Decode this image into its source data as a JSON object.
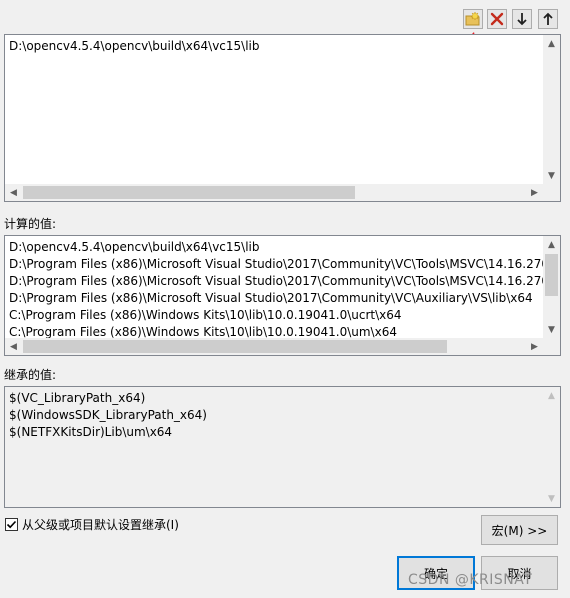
{
  "directory_list": {
    "entries": [
      "D:\\opencv4.5.4\\opencv\\build\\x64\\vc15\\lib"
    ]
  },
  "toolbar": {
    "new_line_icon": "folder-new-icon",
    "delete_icon": "delete-x-icon",
    "move_down_icon": "arrow-down-icon",
    "move_up_icon": "arrow-up-icon"
  },
  "evaluated": {
    "label": "计算的值:",
    "lines": [
      "D:\\opencv4.5.4\\opencv\\build\\x64\\vc15\\lib",
      "D:\\Program Files (x86)\\Microsoft Visual Studio\\2017\\Community\\VC\\Tools\\MSVC\\14.16.270",
      "D:\\Program Files (x86)\\Microsoft Visual Studio\\2017\\Community\\VC\\Tools\\MSVC\\14.16.270",
      "D:\\Program Files (x86)\\Microsoft Visual Studio\\2017\\Community\\VC\\Auxiliary\\VS\\lib\\x64",
      "C:\\Program Files (x86)\\Windows Kits\\10\\lib\\10.0.19041.0\\ucrt\\x64",
      "C:\\Program Files (x86)\\Windows Kits\\10\\lib\\10.0.19041.0\\um\\x64"
    ]
  },
  "inherited": {
    "label": "继承的值:",
    "lines": [
      "$(VC_LibraryPath_x64)",
      "$(WindowsSDK_LibraryPath_x64)",
      "$(NETFXKitsDir)Lib\\um\\x64"
    ]
  },
  "inherit_checkbox": {
    "label": "从父级或项目默认设置继承(I)",
    "checked": true
  },
  "buttons": {
    "macro": "宏(M) >>",
    "ok": "确定",
    "cancel": "取消"
  },
  "watermark": "CSDN @KRISNAT",
  "colors": {
    "annotation_arrow": "#e8202a",
    "default_button_border": "#0078d7",
    "delete_icon": "#c42b1c"
  }
}
